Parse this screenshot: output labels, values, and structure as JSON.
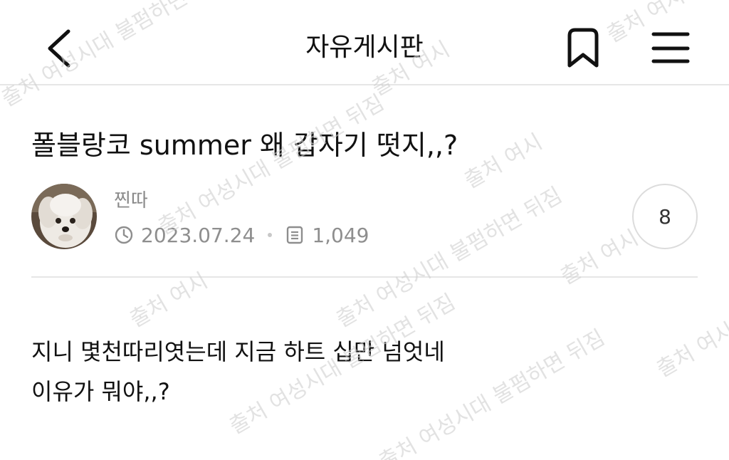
{
  "header": {
    "title": "자유게시판",
    "back_icon": "chevron-left-icon",
    "bookmark_icon": "bookmark-icon",
    "menu_icon": "hamburger-menu-icon"
  },
  "post": {
    "title": "폴블랑코 summer 왜 갑자기 떳지,,?",
    "author": "찐따",
    "date": "2023.07.24",
    "views": "1,049",
    "comment_count": "8",
    "body_lines": [
      "지니 몇천따리엿는데 지금 하트 십만 넘엇네",
      "이유가 뭐야,,?"
    ]
  },
  "watermark": {
    "texts": [
      "출처 여성시대 불펌하면 뒤짐",
      "출처 여시"
    ]
  },
  "colors": {
    "text": "#111111",
    "meta": "#8e8e8e",
    "divider": "#e6e6e6",
    "watermark": "#cfcfcf"
  }
}
